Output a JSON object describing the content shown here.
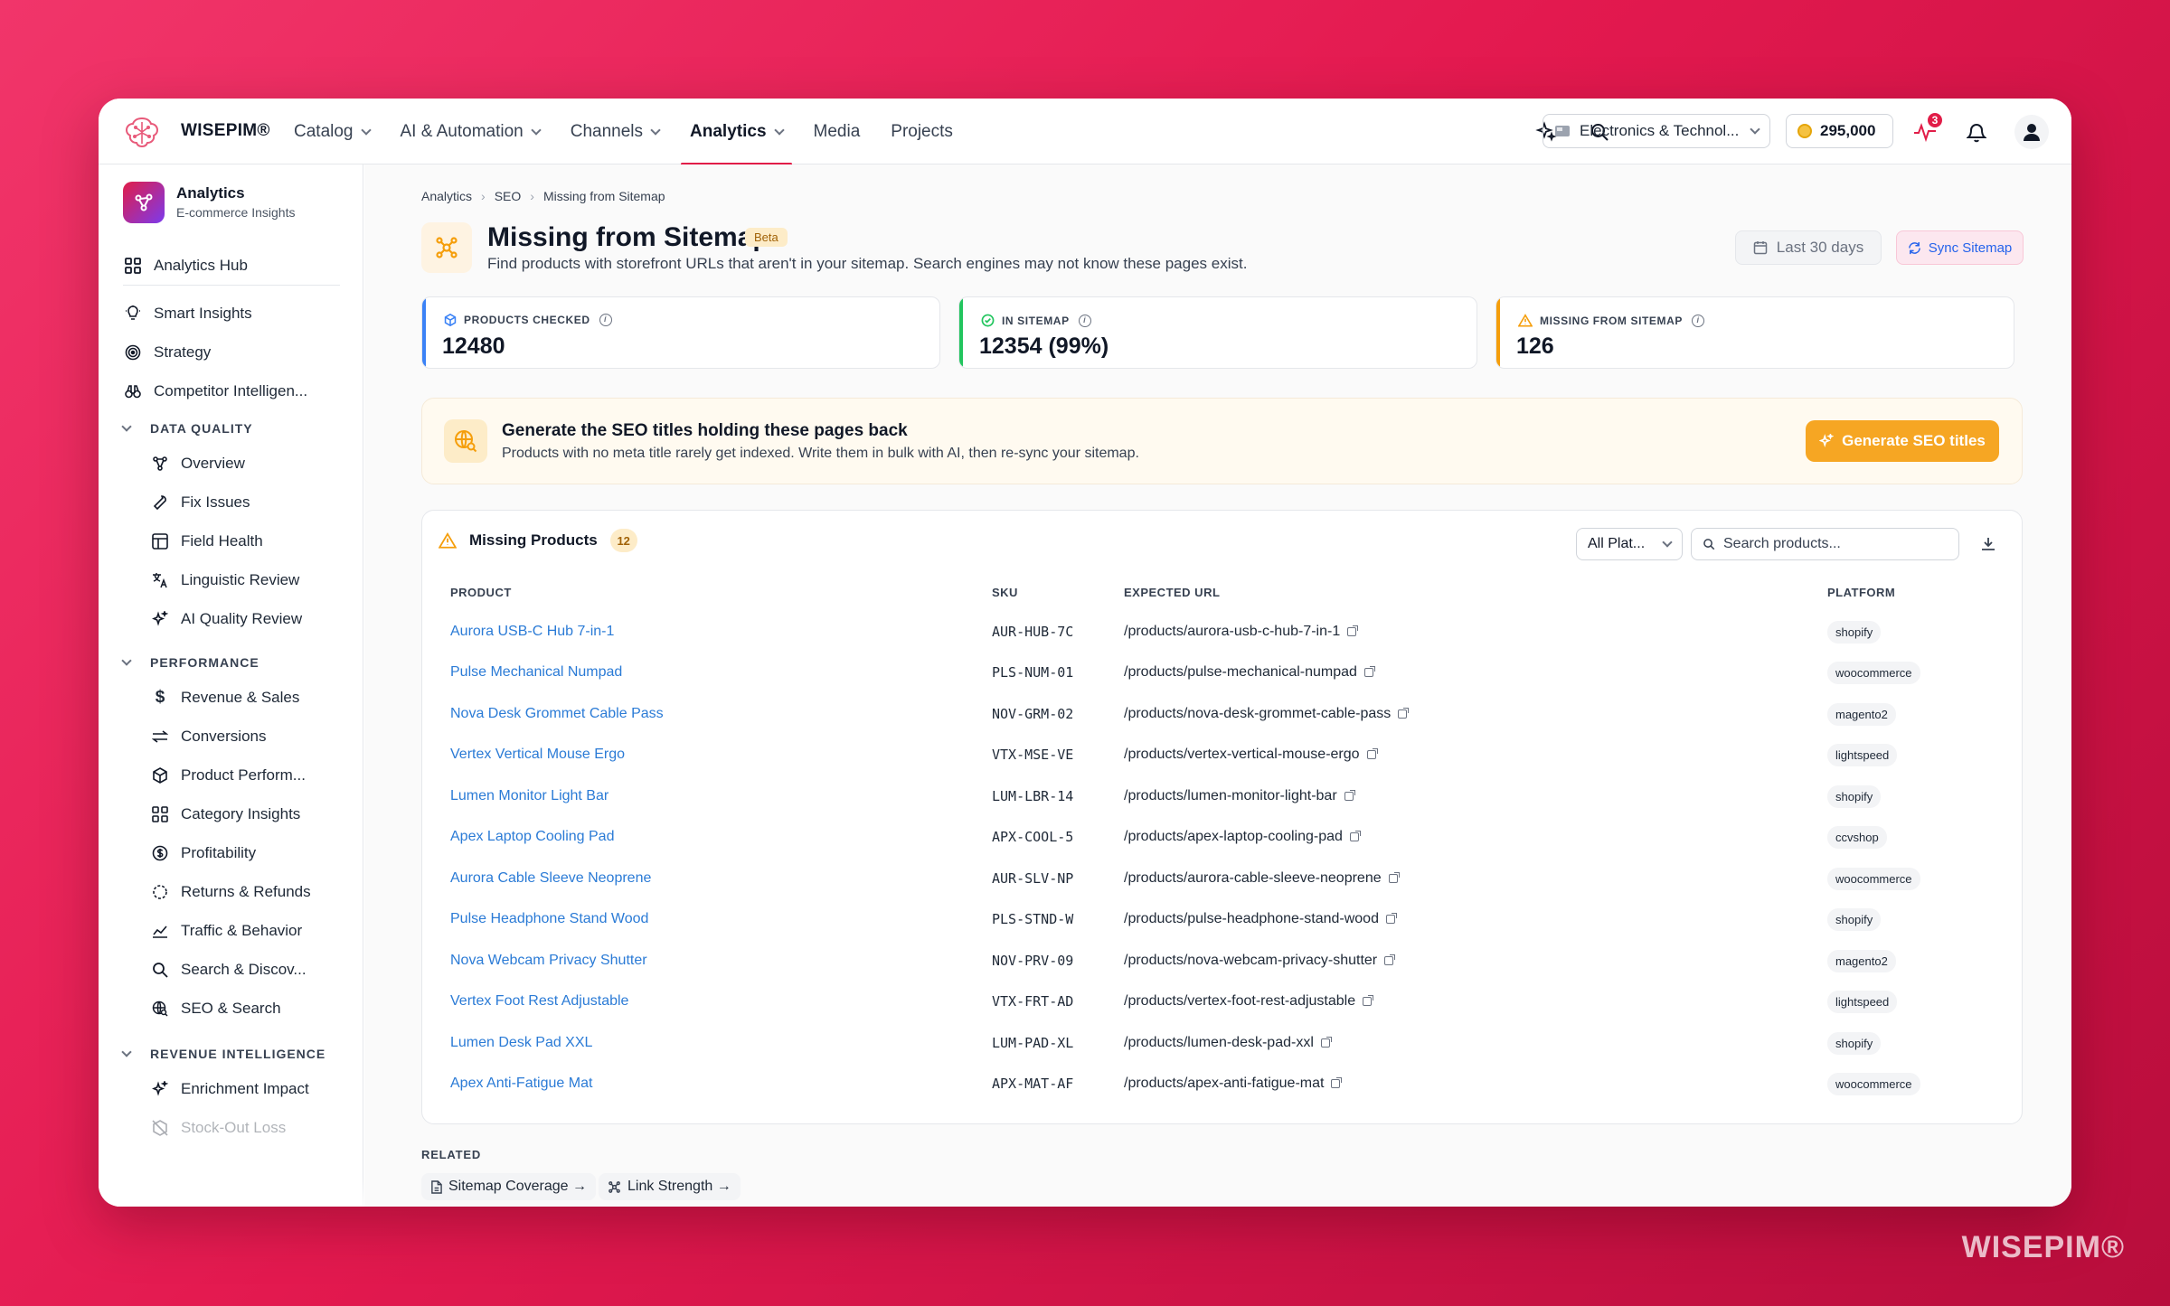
{
  "brand": "WISEPIM®",
  "nav": {
    "items": [
      "Catalog",
      "AI & Automation",
      "Channels",
      "Analytics",
      "Media",
      "Projects"
    ],
    "active": "Analytics"
  },
  "header": {
    "store_label": "Electronics & Technol...",
    "credits": "295,000",
    "notifications_badge": "3"
  },
  "sidebar": {
    "app_title": "Analytics",
    "app_subtitle": "E-commerce Insights",
    "hub": "Analytics Hub",
    "top_items": [
      "Smart Insights",
      "Strategy",
      "Competitor Intelligen..."
    ],
    "sections": [
      {
        "title": "DATA QUALITY",
        "items": [
          "Overview",
          "Fix Issues",
          "Field Health",
          "Linguistic Review",
          "AI Quality Review"
        ]
      },
      {
        "title": "PERFORMANCE",
        "items": [
          "Revenue & Sales",
          "Conversions",
          "Product Perform...",
          "Category Insights",
          "Profitability",
          "Returns & Refunds",
          "Traffic & Behavior",
          "Search & Discov...",
          "SEO & Search"
        ]
      },
      {
        "title": "REVENUE INTELLIGENCE",
        "items": [
          "Enrichment Impact",
          "Stock-Out Loss"
        ]
      }
    ],
    "collapse": "«"
  },
  "breadcrumb": [
    "Analytics",
    "SEO",
    "Missing from Sitemap"
  ],
  "page": {
    "title": "Missing from Sitemap",
    "badge": "Beta",
    "description": "Find products with storefront URLs that aren't in your sitemap. Search engines may not know these pages exist.",
    "range_button": "Last 30 days",
    "sync_button": "Sync Sitemap"
  },
  "stats": [
    {
      "label": "PRODUCTS CHECKED",
      "value": "12480",
      "color": "#3b82f6"
    },
    {
      "label": "IN SITEMAP",
      "value": "12354 (99%)",
      "color": "#22c55e"
    },
    {
      "label": "MISSING FROM SITEMAP",
      "value": "126",
      "color": "#f59e0b"
    }
  ],
  "promo": {
    "title": "Generate the SEO titles holding these pages back",
    "subtitle": "Products with no meta title rarely get indexed. Write them in bulk with AI, then re-sync your sitemap.",
    "button": "Generate SEO titles"
  },
  "table": {
    "title": "Missing Products",
    "count": "12",
    "filter": "All Plat...",
    "search_placeholder": "Search products...",
    "columns": [
      "PRODUCT",
      "SKU",
      "EXPECTED URL",
      "PLATFORM"
    ],
    "rows": [
      {
        "product": "Aurora USB-C Hub 7-in-1",
        "sku": "AUR-HUB-7C",
        "url": "/products/aurora-usb-c-hub-7-in-1",
        "platform": "shopify"
      },
      {
        "product": "Pulse Mechanical Numpad",
        "sku": "PLS-NUM-01",
        "url": "/products/pulse-mechanical-numpad",
        "platform": "woocommerce"
      },
      {
        "product": "Nova Desk Grommet Cable Pass",
        "sku": "NOV-GRM-02",
        "url": "/products/nova-desk-grommet-cable-pass",
        "platform": "magento2"
      },
      {
        "product": "Vertex Vertical Mouse Ergo",
        "sku": "VTX-MSE-VE",
        "url": "/products/vertex-vertical-mouse-ergo",
        "platform": "lightspeed"
      },
      {
        "product": "Lumen Monitor Light Bar",
        "sku": "LUM-LBR-14",
        "url": "/products/lumen-monitor-light-bar",
        "platform": "shopify"
      },
      {
        "product": "Apex Laptop Cooling Pad",
        "sku": "APX-COOL-5",
        "url": "/products/apex-laptop-cooling-pad",
        "platform": "ccvshop"
      },
      {
        "product": "Aurora Cable Sleeve Neoprene",
        "sku": "AUR-SLV-NP",
        "url": "/products/aurora-cable-sleeve-neoprene",
        "platform": "woocommerce"
      },
      {
        "product": "Pulse Headphone Stand Wood",
        "sku": "PLS-STND-W",
        "url": "/products/pulse-headphone-stand-wood",
        "platform": "shopify"
      },
      {
        "product": "Nova Webcam Privacy Shutter",
        "sku": "NOV-PRV-09",
        "url": "/products/nova-webcam-privacy-shutter",
        "platform": "magento2"
      },
      {
        "product": "Vertex Foot Rest Adjustable",
        "sku": "VTX-FRT-AD",
        "url": "/products/vertex-foot-rest-adjustable",
        "platform": "lightspeed"
      },
      {
        "product": "Lumen Desk Pad XXL",
        "sku": "LUM-PAD-XL",
        "url": "/products/lumen-desk-pad-xxl",
        "platform": "shopify"
      },
      {
        "product": "Apex Anti-Fatigue Mat",
        "sku": "APX-MAT-AF",
        "url": "/products/apex-anti-fatigue-mat",
        "platform": "woocommerce"
      }
    ]
  },
  "related": {
    "title": "RELATED",
    "links": [
      "Sitemap Coverage →",
      "Link Strength →"
    ]
  },
  "watermark": "WISEPIM®"
}
